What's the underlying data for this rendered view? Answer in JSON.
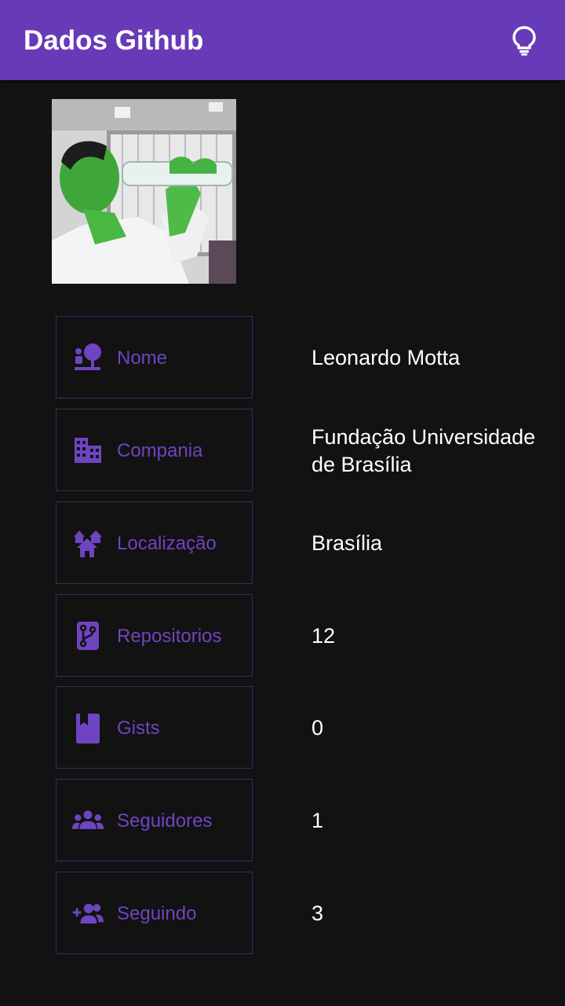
{
  "appbar": {
    "title": "Dados Github",
    "action_icon": "lightbulb-icon",
    "color": "#673ab7"
  },
  "profile": {
    "avatar_icon": "user-photo"
  },
  "colors": {
    "accent": "#673ab7",
    "label": "#6f44c2",
    "background": "#121212",
    "border": "#3a2a63",
    "value": "#ffffff"
  },
  "rows": [
    {
      "label": "Nome",
      "icon": "person-tree-icon",
      "value": "Leonardo Motta"
    },
    {
      "label": "Compania",
      "icon": "building-icon",
      "value": "Fundação Universidade de Brasília"
    },
    {
      "label": "Localização",
      "icon": "houses-icon",
      "value": "Brasília"
    },
    {
      "label": "Repositorios",
      "icon": "source-branch-icon",
      "value": "12"
    },
    {
      "label": "Gists",
      "icon": "bookmark-book-icon",
      "value": "0"
    },
    {
      "label": "Seguidores",
      "icon": "people-group-icon",
      "value": "1"
    },
    {
      "label": "Seguindo",
      "icon": "add-people-icon",
      "value": "3"
    }
  ]
}
